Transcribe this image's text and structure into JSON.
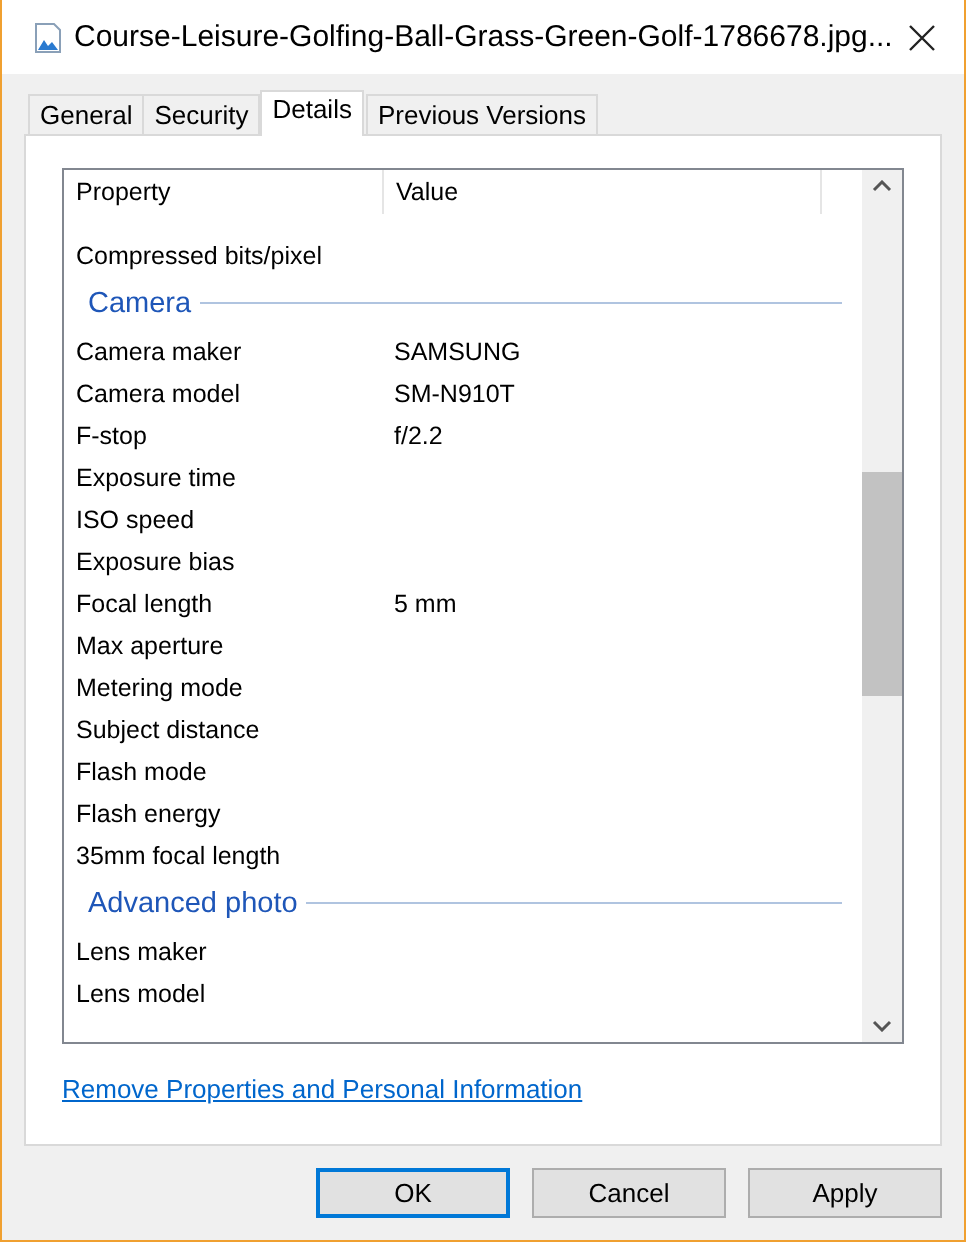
{
  "window": {
    "title": "Course-Leisure-Golfing-Ball-Grass-Green-Golf-1786678.jpg..."
  },
  "tabs": [
    {
      "label": "General",
      "selected": false
    },
    {
      "label": "Security",
      "selected": false
    },
    {
      "label": "Details",
      "selected": true
    },
    {
      "label": "Previous Versions",
      "selected": false
    }
  ],
  "list": {
    "columns": [
      "Property",
      "Value"
    ],
    "rows": [
      {
        "kind": "row",
        "property": "Compressed bits/pixel",
        "value": ""
      },
      {
        "kind": "group",
        "property": "Camera"
      },
      {
        "kind": "row",
        "property": "Camera maker",
        "value": "SAMSUNG"
      },
      {
        "kind": "row",
        "property": "Camera model",
        "value": "SM-N910T"
      },
      {
        "kind": "row",
        "property": "F-stop",
        "value": "f/2.2"
      },
      {
        "kind": "row",
        "property": "Exposure time",
        "value": ""
      },
      {
        "kind": "row",
        "property": "ISO speed",
        "value": ""
      },
      {
        "kind": "row",
        "property": "Exposure bias",
        "value": ""
      },
      {
        "kind": "row",
        "property": "Focal length",
        "value": "5 mm"
      },
      {
        "kind": "row",
        "property": "Max aperture",
        "value": ""
      },
      {
        "kind": "row",
        "property": "Metering mode",
        "value": ""
      },
      {
        "kind": "row",
        "property": "Subject distance",
        "value": ""
      },
      {
        "kind": "row",
        "property": "Flash mode",
        "value": ""
      },
      {
        "kind": "row",
        "property": "Flash energy",
        "value": ""
      },
      {
        "kind": "row",
        "property": "35mm focal length",
        "value": ""
      },
      {
        "kind": "group",
        "property": "Advanced photo"
      },
      {
        "kind": "row",
        "property": "Lens maker",
        "value": ""
      },
      {
        "kind": "row",
        "property": "Lens model",
        "value": ""
      }
    ]
  },
  "link": "Remove Properties and Personal Information",
  "buttons": [
    {
      "label": "OK",
      "default": true
    },
    {
      "label": "Cancel",
      "default": false
    },
    {
      "label": "Apply",
      "default": false
    }
  ]
}
